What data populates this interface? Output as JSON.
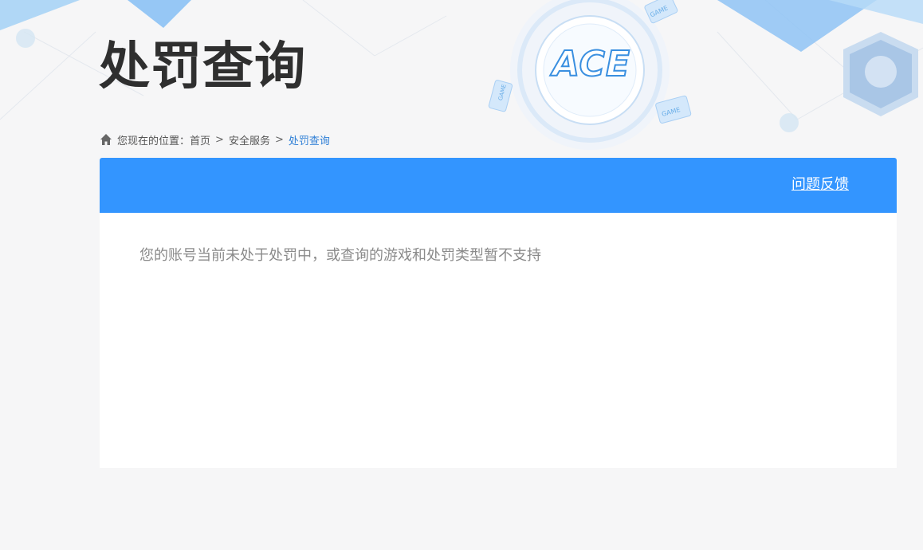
{
  "header": {
    "title": "处罚查询",
    "logo_text": "ACE",
    "decor_badge_text": "GAME"
  },
  "breadcrumb": {
    "prefix": "您现在的位置：",
    "items": [
      {
        "label": "首页"
      },
      {
        "label": "安全服务"
      },
      {
        "label": "处罚查询"
      }
    ],
    "separator": ">"
  },
  "panel": {
    "feedback_label": "问题反馈",
    "message": "您的账号当前未处于处罚中，或查询的游戏和处罚类型暂不支持"
  },
  "colors": {
    "accent": "#3395ff",
    "background": "#f6f6f7",
    "title": "#2f2f2f",
    "breadcrumb_current": "#2f7fd6",
    "message": "#8a8a8a"
  }
}
